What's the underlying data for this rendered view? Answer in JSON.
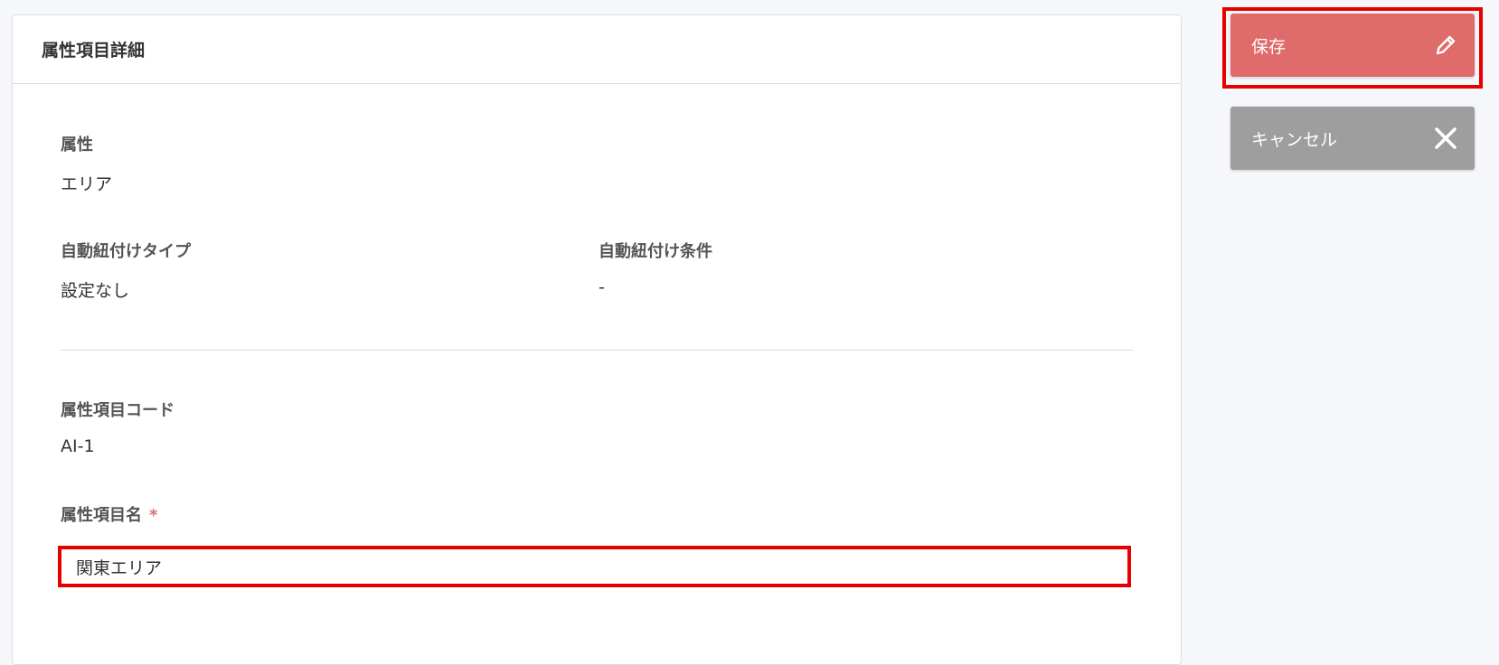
{
  "card": {
    "title": "属性項目詳細"
  },
  "fields": {
    "attribute": {
      "label": "属性",
      "value": "エリア"
    },
    "auto_link_type": {
      "label": "自動紐付けタイプ",
      "value": "設定なし"
    },
    "auto_link_condition": {
      "label": "自動紐付け条件",
      "value": "-"
    },
    "item_code": {
      "label": "属性項目コード",
      "value": "AI-1"
    },
    "item_name": {
      "label": "属性項目名",
      "required_mark": "*",
      "value": "関東エリア"
    }
  },
  "actions": {
    "save_label": "保存",
    "cancel_label": "キャンセル",
    "save_icon": "pencil-icon",
    "cancel_icon": "close-icon"
  },
  "colors": {
    "save_button": "#e06b6b",
    "cancel_button": "#9e9e9e",
    "highlight_border": "#e60000",
    "required": "#e06a6a"
  }
}
